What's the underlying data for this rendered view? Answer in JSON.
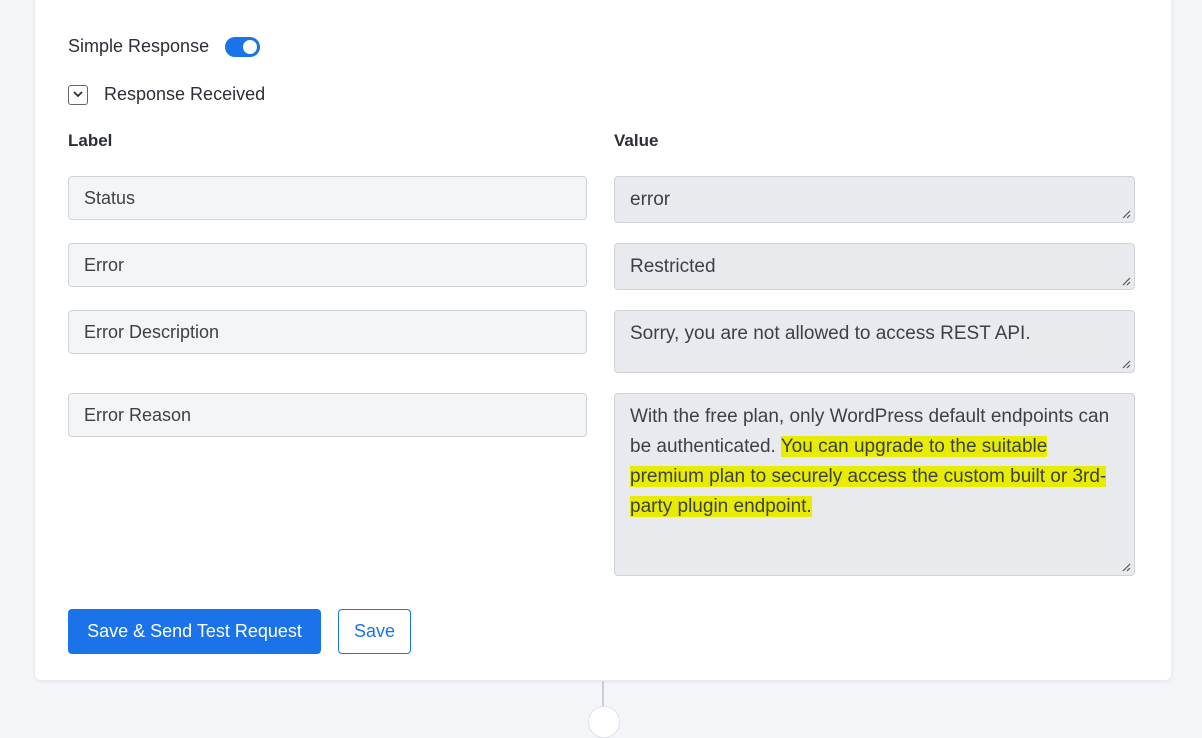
{
  "simple_response": {
    "label": "Simple Response",
    "enabled": true
  },
  "response_section": {
    "label": "Response Received",
    "expanded": true
  },
  "columns": {
    "label_header": "Label",
    "value_header": "Value"
  },
  "rows": [
    {
      "label": "Status",
      "value": "error"
    },
    {
      "label": "Error",
      "value": "Restricted"
    },
    {
      "label": "Error Description",
      "value": "Sorry, you are not allowed to access REST API."
    },
    {
      "label": "Error Reason",
      "value_plain": "With the free plan, only WordPress default endpoints can be authenticated. ",
      "value_highlight": "You can upgrade to the suitable premium plan to securely access the custom built or 3rd-party plugin endpoint."
    }
  ],
  "actions": {
    "primary_label": "Save & Send Test Request",
    "secondary_label": "Save"
  },
  "colors": {
    "accent": "#1a73e8",
    "highlight": "#e8ec00"
  }
}
